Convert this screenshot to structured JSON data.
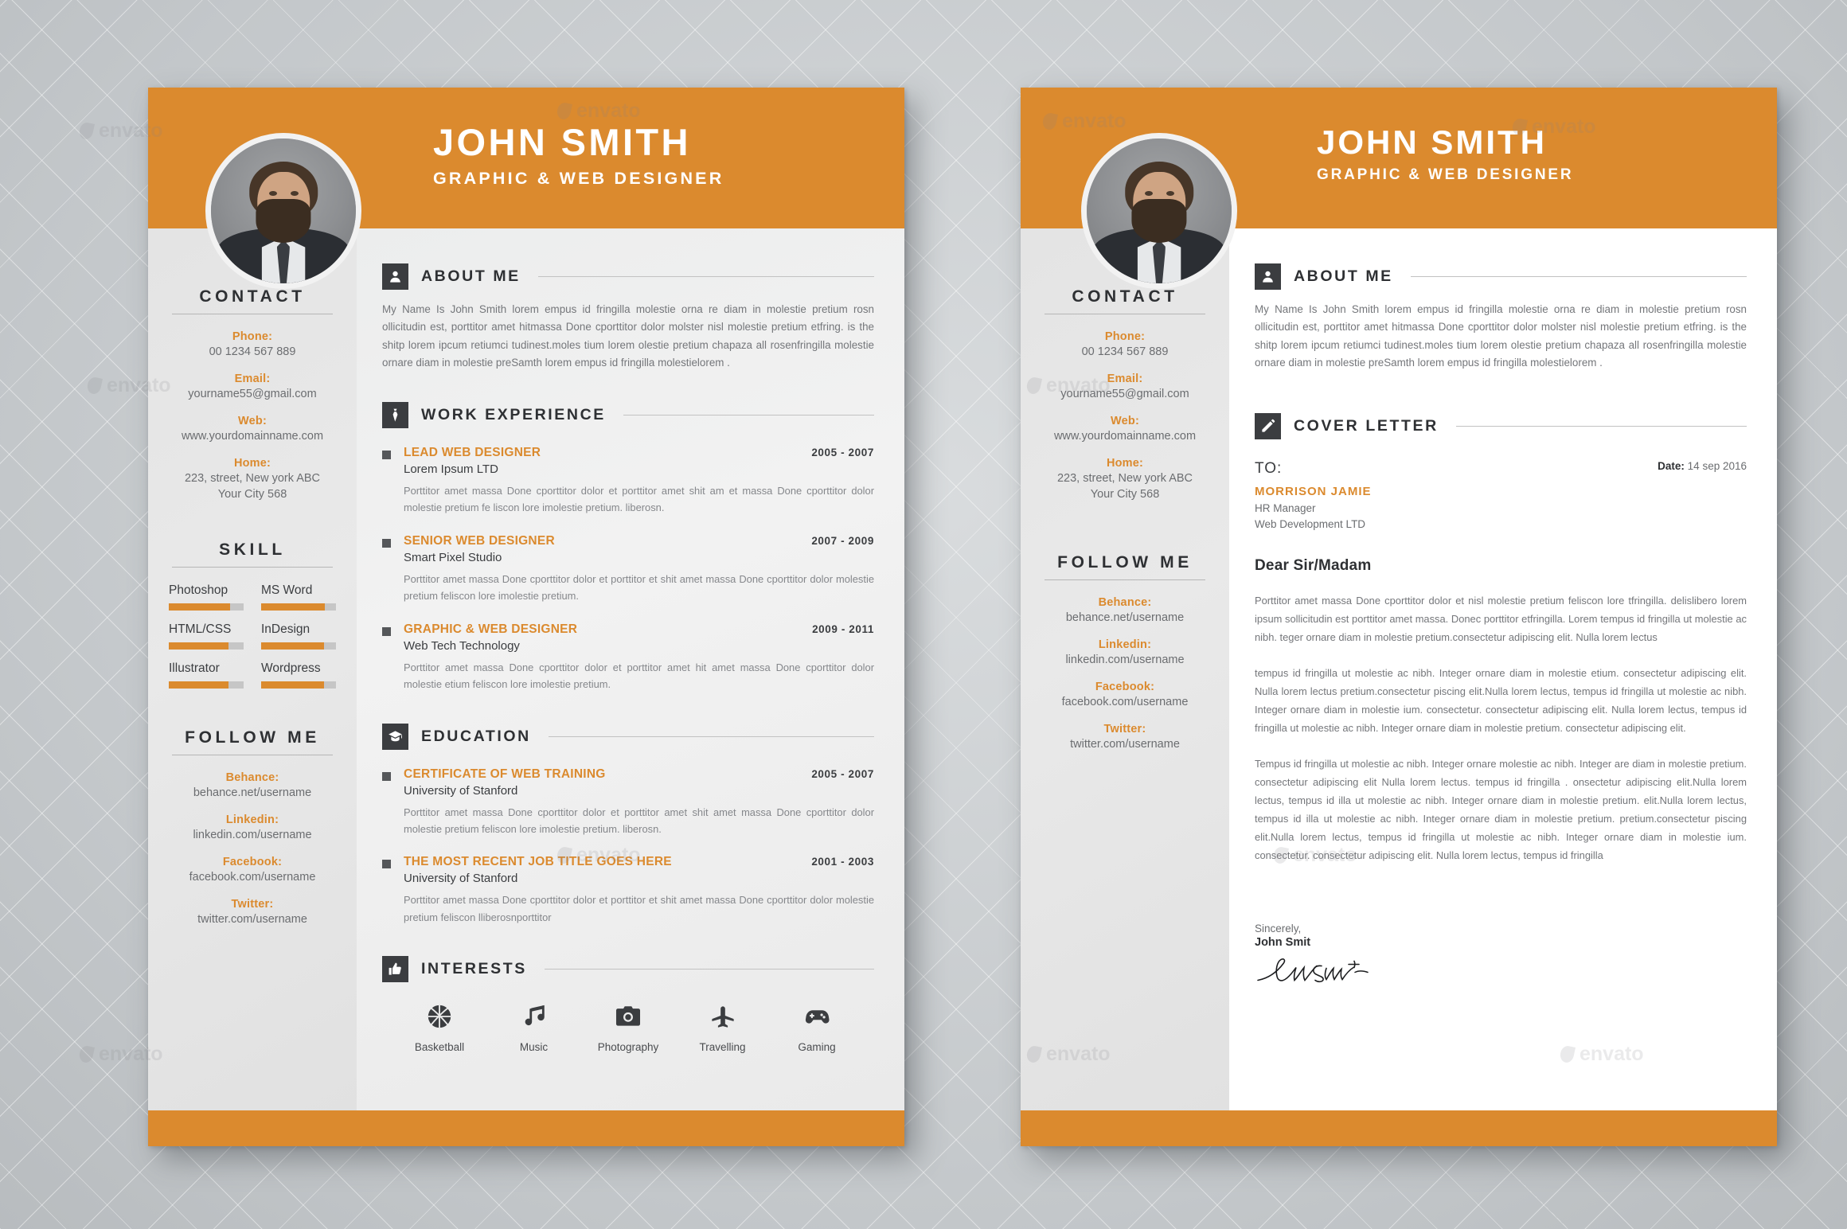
{
  "header": {
    "name": "JOHN SMITH",
    "role": "GRAPHIC & WEB DESIGNER"
  },
  "colors": {
    "accent": "#db8a2e",
    "dark": "#3b3d40",
    "body_text": "#74767a",
    "page_bg": "#ececec"
  },
  "sidebar": {
    "contact": {
      "title": "CONTACT",
      "items": [
        {
          "label": "Phone:",
          "value": "00 1234 567 889"
        },
        {
          "label": "Email:",
          "value": "yourname55@gmail.com"
        },
        {
          "label": "Web:",
          "value": "www.yourdomainname.com"
        },
        {
          "label": "Home:",
          "value": "223, street, New york ABC\nYour City 568"
        }
      ]
    },
    "skill": {
      "title": "SKILL",
      "items": [
        {
          "name": "Photoshop",
          "percent": 82
        },
        {
          "name": "MS Word",
          "percent": 85
        },
        {
          "name": "HTML/CSS",
          "percent": 80
        },
        {
          "name": "InDesign",
          "percent": 84
        },
        {
          "name": "Illustrator",
          "percent": 80
        },
        {
          "name": "Wordpress",
          "percent": 84
        }
      ]
    },
    "follow": {
      "title": "FOLLOW ME",
      "items": [
        {
          "label": "Behance:",
          "value": "behance.net/username"
        },
        {
          "label": "Linkedin:",
          "value": "linkedin.com/username"
        },
        {
          "label": "Facebook:",
          "value": "facebook.com/username"
        },
        {
          "label": "Twitter:",
          "value": "twitter.com/username"
        }
      ]
    }
  },
  "resume": {
    "about": {
      "title": "ABOUT ME",
      "icon": "user-icon",
      "text": "My Name Is John Smith lorem empus id fringilla molestie orna re diam in molestie pretium rosn ollicitudin est, porttitor amet hitmassa Done cporttitor dolor molster nisl molestie pretium etfring. is the shitp lorem ipcum retiumci tudinest.moles tium   lorem olestie pretium chapaza all rosenfringilla molestie ornare diam in molestie preSamth lorem empus id fringilla molestielorem ."
    },
    "work": {
      "title": "WORK EXPERIENCE",
      "icon": "tie-icon",
      "entries": [
        {
          "title": "LEAD WEB DESIGNER",
          "org": "Lorem  Ipsum LTD",
          "date": "2005 - 2007",
          "desc": "Porttitor amet massa Done cporttitor dolor et porttitor amet shit am et massa Done cporttitor dolor molestie pretium fe liscon lore imolestie pretium. liberosn."
        },
        {
          "title": "SENIOR WEB DESIGNER",
          "org": "Smart Pixel Studio",
          "date": "2007 - 2009",
          "desc": "Porttitor amet massa Done cporttitor dolor et porttitor et shit amet massa Done cporttitor dolor molestie pretium feliscon lore imolestie pretium."
        },
        {
          "title": "GRAPHIC & WEB DESIGNER",
          "org": "Web Tech Technology",
          "date": "2009 - 2011",
          "desc": "Porttitor amet massa Done cporttitor dolor et porttitor amet hit amet massa Done cporttitor dolor molestie etium feliscon lore imolestie pretium."
        }
      ]
    },
    "education": {
      "title": "EDUCATION",
      "icon": "graduation-cap-icon",
      "entries": [
        {
          "title": "CERTIFICATE OF WEB TRAINING",
          "org": "University of Stanford",
          "date": "2005 - 2007",
          "desc": "Porttitor amet massa Done cporttitor dolor et porttitor amet shit amet massa Done cporttitor dolor molestie pretium feliscon lore imolestie pretium. liberosn."
        },
        {
          "title": "THE MOST RECENT JOB TITLE GOES HERE",
          "org": "University of Stanford",
          "date": "2001 - 2003",
          "desc": "Porttitor amet massa Done cporttitor dolor et porttitor et shit amet massa Done cporttitor dolor molestie pretium feliscon lliberosnporttitor"
        }
      ]
    },
    "interests": {
      "title": "INTERESTS",
      "icon": "thumbs-up-icon",
      "items": [
        {
          "label": "Basketball",
          "icon": "basketball-icon"
        },
        {
          "label": "Music",
          "icon": "music-note-icon"
        },
        {
          "label": "Photography",
          "icon": "camera-icon"
        },
        {
          "label": "Travelling",
          "icon": "airplane-icon"
        },
        {
          "label": "Gaming",
          "icon": "gamepad-icon"
        }
      ]
    }
  },
  "cover": {
    "about": {
      "title": "ABOUT ME",
      "icon": "user-icon",
      "text": "My Name Is John Smith lorem empus id fringilla molestie orna re diam in molestie pretium rosn ollicitudin est, porttitor amet hitmassa Done cporttitor dolor molster nisl molestie pretium etfring. is the shitp lorem ipcum retiumci tudinest.moles tium   lorem olestie pretium chapaza all rosenfringilla molestie ornare diam in molestie preSamth lorem empus id fringilla molestielorem ."
    },
    "letter": {
      "title": "COVER LETTER",
      "icon": "pencil-icon",
      "to_label": "TO:",
      "to_name": "MORRISON JAMIE",
      "to_role": "HR Manager",
      "to_company": "Web Development LTD",
      "date_label": "Date:",
      "date_value": "14 sep 2016",
      "salutation": "Dear Sir/Madam",
      "paragraphs": [
        "Porttitor amet massa Done cporttitor dolor et nisl molestie pretium feliscon  lore  tfringilla. delislibero lorem ipsum sollicitudin est porttitor amet massa. Donec porttitor etfringilla. Lorem tempus id fringilla ut molestie ac nibh.  teger ornare diam in molestie pretium.consectetur adipiscing elit. Nulla lorem lectus",
        "tempus id fringilla ut molestie ac nibh. Integer ornare diam in molestie etium. consectetur adipiscing elit. Nulla lorem lectus pretium.consectetur  piscing elit.Nulla lorem lectus, tempus id fringilla ut molestie ac nibh. Integer ornare diam in molestie  ium. consectetur. consectetur adipiscing elit. Nulla lorem lectus, tempus id fringilla ut molestie ac nibh. Integer ornare diam in molestie  pretium. consectetur adipiscing elit.",
        "Tempus id fringilla ut molestie ac nibh. Integer ornare molestie ac nibh. Integer  are diam in molestie pretium. consectetur adipiscing elit Nulla lorem lectus.  tempus id fringilla .  onsectetur adipiscing elit.Nulla lorem lectus, tempus id illa ut molestie ac nibh. Integer ornare diam in molestie pretium. elit.Nulla lorem lectus, tempus id illa ut molestie ac nibh. Integer ornare diam in molestie pretium. pretium.consectetur  piscing elit.Nulla lorem lectus, tempus id fringilla ut molestie ac nibh. Integer ornare diam in molestie  ium. consectetur. consectetur adipiscing elit. Nulla lorem lectus, tempus id fringilla"
      ],
      "sign_off": "Sincerely,",
      "sign_name": "John Smit",
      "signature_mark": "John Smith"
    }
  },
  "watermark": {
    "text": "envato"
  }
}
